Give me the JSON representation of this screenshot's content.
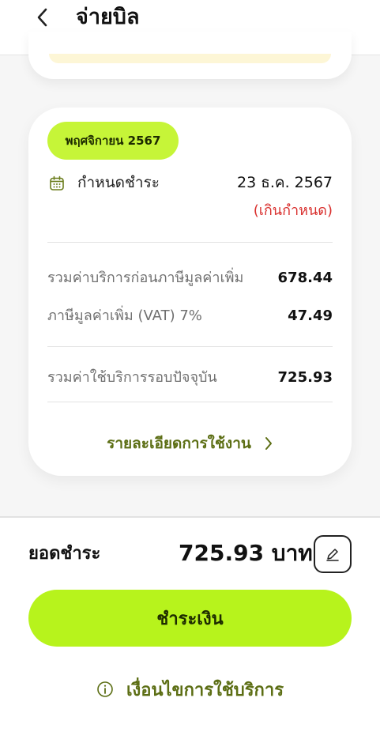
{
  "header": {
    "title": "จ่ายบิล"
  },
  "bill": {
    "month_label": "พฤศจิกายน 2567",
    "due_label": "กำหนดชำระ",
    "due_date": "23 ธ.ค. 2567",
    "overdue_label": "(เกินกำหนด)",
    "rows": [
      {
        "label": "รวมค่าบริการก่อนภาษีมูลค่าเพิ่ม",
        "value": "678.44"
      },
      {
        "label": "ภาษีมูลค่าเพิ่ม (VAT) 7%",
        "value": "47.49"
      },
      {
        "label": "รวมค่าใช้บริการรอบปัจจุบัน",
        "value": "725.93"
      }
    ],
    "details_link": "รายละเอียดการใช้งาน"
  },
  "footer": {
    "total_label": "ยอดชำระ",
    "total_amount": "725.93 บาท",
    "pay_button": "ชำระเงิน",
    "terms_link": "เงื่อนไขการใช้บริการ"
  },
  "colors": {
    "accent": "#b7f31c",
    "pill": "#c6f538",
    "link": "#5c6e14",
    "overdue": "#d9302e"
  },
  "icons": {
    "back": "chevron-left-icon",
    "calendar": "calendar-icon",
    "details": "chevron-right-icon",
    "edit": "pencil-icon",
    "terms": "info-icon"
  }
}
